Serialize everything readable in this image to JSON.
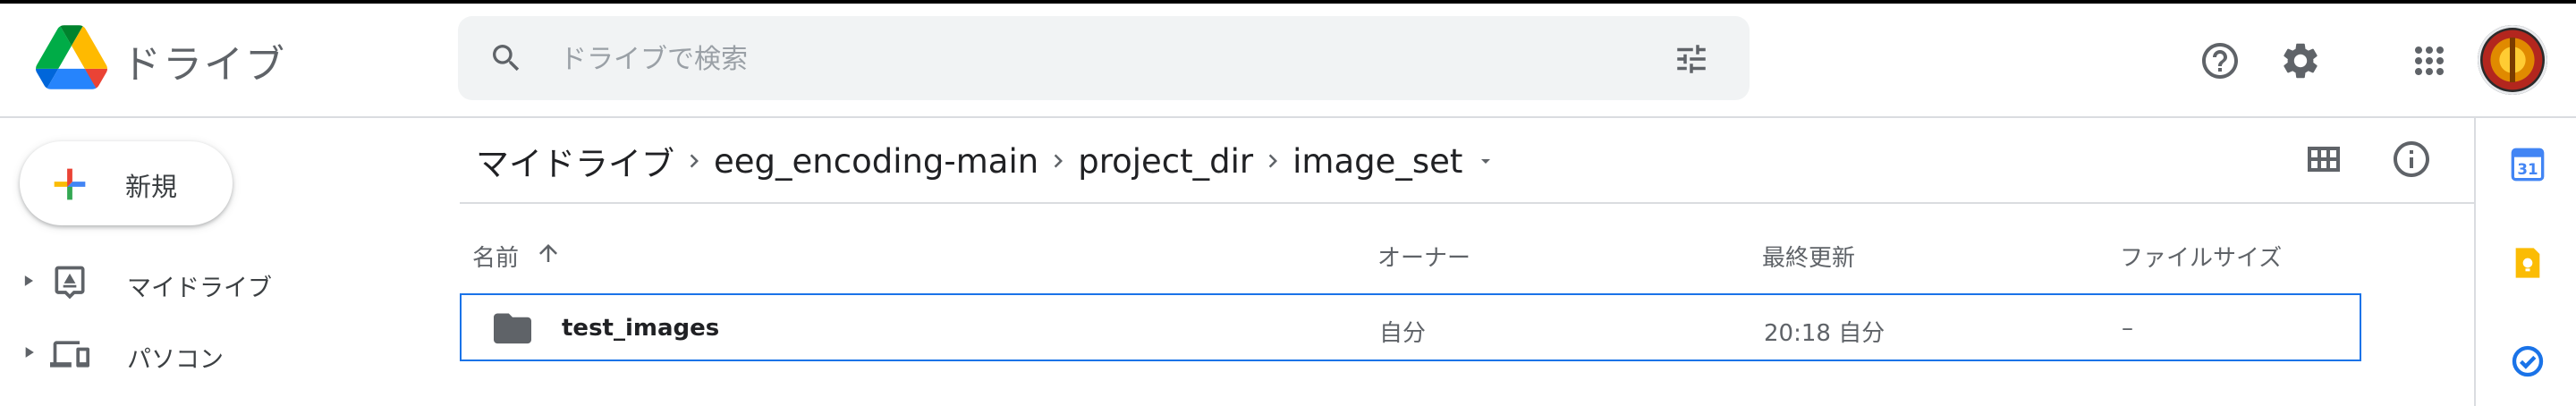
{
  "header": {
    "app_name": "ドライブ",
    "search_placeholder": "ドライブで検索",
    "help_icon": "help-icon",
    "settings_icon": "gear-icon",
    "apps_icon": "apps-grid-icon"
  },
  "sidebar": {
    "new_label": "新規",
    "items": [
      {
        "label": "マイドライブ",
        "icon": "drive-folder-icon"
      },
      {
        "label": "パソコン",
        "icon": "computers-icon"
      }
    ]
  },
  "breadcrumb": {
    "items": [
      "マイドライブ",
      "eeg_encoding-main",
      "project_dir",
      "image_set"
    ]
  },
  "table": {
    "columns": {
      "name": "名前",
      "owner": "オーナー",
      "modified": "最終更新",
      "size": "ファイルサイズ"
    },
    "sort": "ascending",
    "rows": [
      {
        "name": "test_images",
        "owner": "自分",
        "modified": "20:18 自分",
        "size": "–",
        "type": "folder"
      }
    ]
  },
  "colors": {
    "accent": "#1a73e8",
    "text_primary": "#202124",
    "text_secondary": "#5f6368",
    "search_bg": "#f1f3f4",
    "divider": "#dadce0"
  }
}
